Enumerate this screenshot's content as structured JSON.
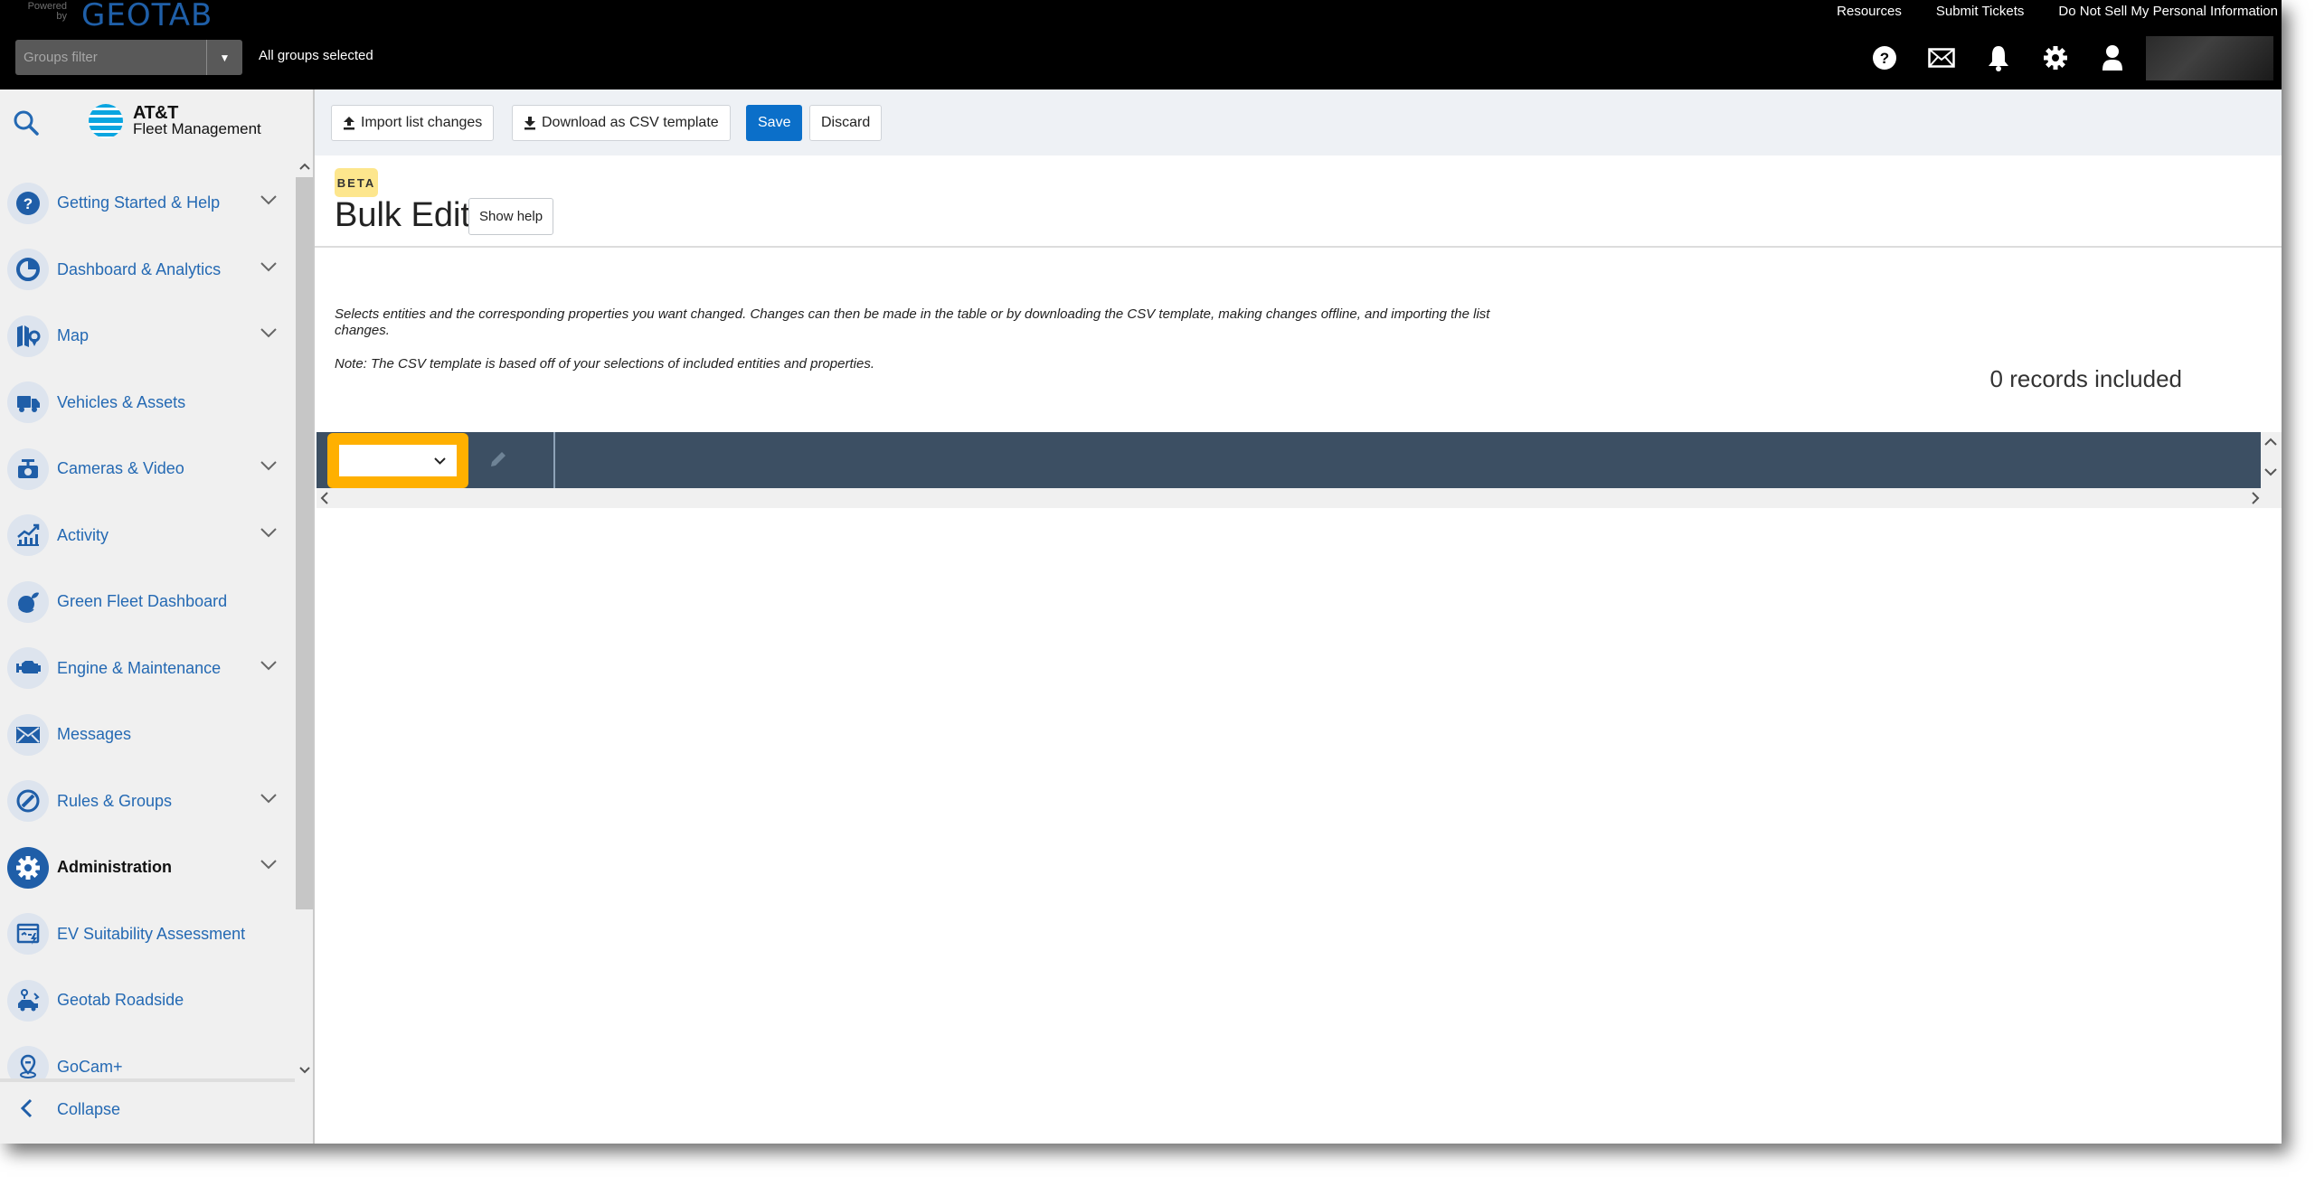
{
  "header": {
    "powered_by": "Powered by",
    "brand": "GEOTAB",
    "groups_filter": {
      "placeholder": "Groups filter",
      "value": ""
    },
    "groups_status": "All groups selected",
    "links": [
      "Resources",
      "Submit Tickets",
      "Do Not Sell My Personal Information"
    ],
    "icons": [
      "help-icon",
      "mail-icon",
      "bell-icon",
      "gear-icon",
      "user-icon"
    ],
    "user_name": ""
  },
  "sidebar": {
    "logo": {
      "line1": "AT&T",
      "line2": "Fleet Management"
    },
    "items": [
      {
        "label": "Getting Started & Help",
        "icon": "help-icon",
        "expandable": true,
        "active": false
      },
      {
        "label": "Dashboard & Analytics",
        "icon": "pie-chart-icon",
        "expandable": true,
        "active": false
      },
      {
        "label": "Map",
        "icon": "map-icon",
        "expandable": true,
        "active": false
      },
      {
        "label": "Vehicles & Assets",
        "icon": "truck-icon",
        "expandable": false,
        "active": false
      },
      {
        "label": "Cameras & Video",
        "icon": "camera-icon",
        "expandable": true,
        "active": false
      },
      {
        "label": "Activity",
        "icon": "activity-chart-icon",
        "expandable": true,
        "active": false
      },
      {
        "label": "Green Fleet Dashboard",
        "icon": "green-fleet-icon",
        "expandable": false,
        "active": false
      },
      {
        "label": "Engine & Maintenance",
        "icon": "engine-icon",
        "expandable": true,
        "active": false
      },
      {
        "label": "Messages",
        "icon": "mail-icon",
        "expandable": false,
        "active": false
      },
      {
        "label": "Rules & Groups",
        "icon": "rules-icon",
        "expandable": true,
        "active": false
      },
      {
        "label": "Administration",
        "icon": "gear-icon",
        "expandable": true,
        "active": true
      },
      {
        "label": "EV Suitability Assessment",
        "icon": "ev-assessment-icon",
        "expandable": false,
        "active": false
      },
      {
        "label": "Geotab Roadside",
        "icon": "roadside-icon",
        "expandable": false,
        "active": false
      },
      {
        "label": "GoCam+",
        "icon": "gocam-icon",
        "expandable": false,
        "active": false
      }
    ],
    "collapse_label": "Collapse"
  },
  "toolbar": {
    "import_label": "Import list changes",
    "download_label": "Download as CSV template",
    "save_label": "Save",
    "discard_label": "Discard"
  },
  "page": {
    "badge": "BETA",
    "title": "Bulk Edit",
    "show_help_label": "Show help",
    "description": "Selects entities and the corresponding properties you want changed. Changes can then be made in the table or by downloading the CSV template, making changes offline, and importing the list changes.",
    "note": "Note: The CSV template is based off of your selections of included entities and properties.",
    "records_included": "0 records included"
  },
  "grid": {
    "entity_select": {
      "value": ""
    }
  },
  "colors": {
    "header_bg": "#000000",
    "brand_blue": "#1f5fa8",
    "nav_text": "#2469b3",
    "primary_button": "#0b6fc9",
    "beta_badge": "#fde68d",
    "grid_header": "#3c4f63",
    "highlight": "#ffb000"
  }
}
